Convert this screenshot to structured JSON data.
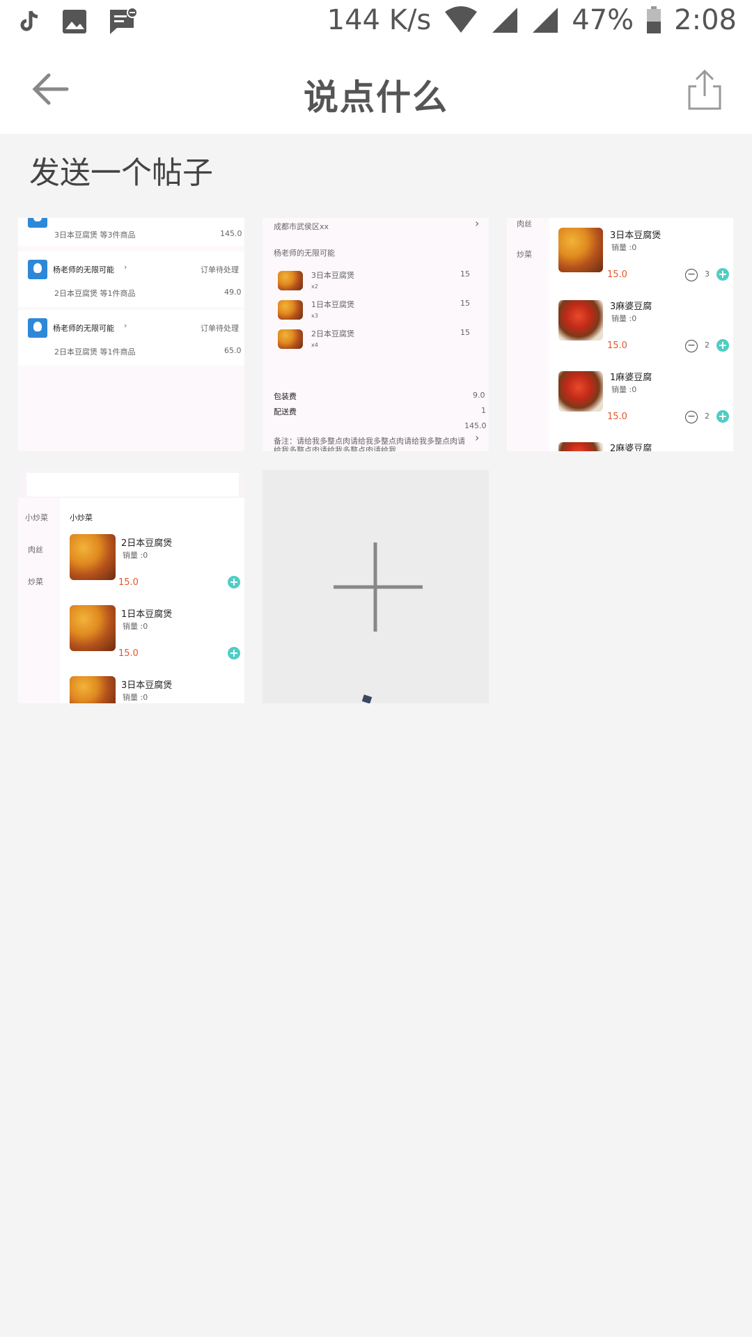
{
  "status_bar": {
    "net_speed": "144 K/s",
    "battery": "47%",
    "time": "2:08"
  },
  "app_bar": {
    "title": "说点什么"
  },
  "page": {
    "subtitle": "发送一个帖子"
  },
  "thumb1": {
    "row0_desc": "3日本豆腐煲 等3件商品",
    "row0_amount": "145.0",
    "rows": [
      {
        "shop": "杨老师的无限可能",
        "status": "订单待处理",
        "desc": "2日本豆腐煲 等1件商品",
        "amount": "49.0"
      },
      {
        "shop": "杨老师的无限可能",
        "status": "订单待处理",
        "desc": "2日本豆腐煲 等1件商品",
        "amount": "65.0"
      }
    ]
  },
  "thumb2": {
    "address": "成都市武侯区xx",
    "shop": "杨老师的无限可能",
    "items": [
      {
        "name": "3日本豆腐煲",
        "qty": "x2",
        "price": "15"
      },
      {
        "name": "1日本豆腐煲",
        "qty": "x3",
        "price": "15"
      },
      {
        "name": "2日本豆腐煲",
        "qty": "x4",
        "price": "15"
      }
    ],
    "pack_label": "包装费",
    "pack_value": "9.0",
    "delivery_label": "配送费",
    "delivery_value": "1",
    "total": "145.0",
    "note": "备注：请给我多整点肉请给我多整点肉请给我多整点肉请给我多整点肉请给我多整点肉请给我"
  },
  "thumb3": {
    "cat1": "肉丝",
    "cat2": "炒菜",
    "items": [
      {
        "name": "3日本豆腐煲",
        "sales": "销量 :0",
        "price": "15.0",
        "count": "3"
      },
      {
        "name": "3麻婆豆腐",
        "sales": "销量 :0",
        "price": "15.0",
        "count": "2"
      },
      {
        "name": "1麻婆豆腐",
        "sales": "销量 :0",
        "price": "15.0",
        "count": "2"
      },
      {
        "name": "2麻婆豆腐"
      }
    ]
  },
  "thumb4": {
    "cat0": "小炒菜",
    "cat1": "肉丝",
    "cat2": "炒菜",
    "header": "小炒菜",
    "items": [
      {
        "name": "2日本豆腐煲",
        "sales": "销量 :0",
        "price": "15.0"
      },
      {
        "name": "1日本豆腐煲",
        "sales": "销量 :0",
        "price": "15.0"
      },
      {
        "name": "3日本豆腐煲",
        "sales": "销量 :0"
      }
    ]
  },
  "icons": [
    "tiktok-icon",
    "image-icon",
    "message-icon",
    "wifi-icon",
    "signal-icon",
    "battery-icon",
    "back-arrow-icon",
    "share-icon",
    "plus-icon"
  ]
}
